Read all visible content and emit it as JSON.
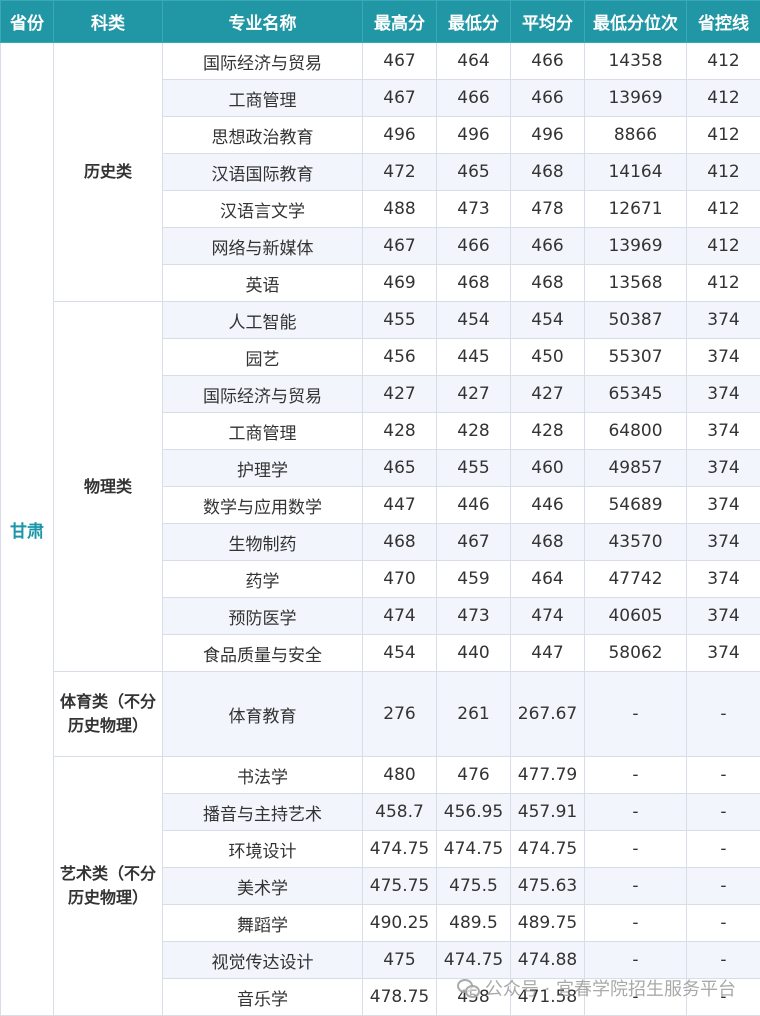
{
  "headers": [
    "省份",
    "科类",
    "专业名称",
    "最高分",
    "最低分",
    "平均分",
    "最低分位次",
    "省控线"
  ],
  "province": "甘肃",
  "groups": [
    {
      "subject": "历史类",
      "rows": [
        [
          "国际经济与贸易",
          "467",
          "464",
          "466",
          "14358",
          "412"
        ],
        [
          "工商管理",
          "467",
          "466",
          "466",
          "13969",
          "412"
        ],
        [
          "思想政治教育",
          "496",
          "496",
          "496",
          "8866",
          "412"
        ],
        [
          "汉语国际教育",
          "472",
          "465",
          "468",
          "14164",
          "412"
        ],
        [
          "汉语言文学",
          "488",
          "473",
          "478",
          "12671",
          "412"
        ],
        [
          "网络与新媒体",
          "467",
          "466",
          "466",
          "13969",
          "412"
        ],
        [
          "英语",
          "469",
          "468",
          "468",
          "13568",
          "412"
        ]
      ]
    },
    {
      "subject": "物理类",
      "rows": [
        [
          "人工智能",
          "455",
          "454",
          "454",
          "50387",
          "374"
        ],
        [
          "园艺",
          "456",
          "445",
          "450",
          "55307",
          "374"
        ],
        [
          "国际经济与贸易",
          "427",
          "427",
          "427",
          "65345",
          "374"
        ],
        [
          "工商管理",
          "428",
          "428",
          "428",
          "64800",
          "374"
        ],
        [
          "护理学",
          "465",
          "455",
          "460",
          "49857",
          "374"
        ],
        [
          "数学与应用数学",
          "447",
          "446",
          "446",
          "54689",
          "374"
        ],
        [
          "生物制药",
          "468",
          "467",
          "468",
          "43570",
          "374"
        ],
        [
          "药学",
          "470",
          "459",
          "464",
          "47742",
          "374"
        ],
        [
          "预防医学",
          "474",
          "473",
          "474",
          "40605",
          "374"
        ],
        [
          "食品质量与安全",
          "454",
          "440",
          "447",
          "58062",
          "374"
        ]
      ]
    },
    {
      "subject": "体育类（不分历史物理）",
      "tall": true,
      "rows": [
        [
          "体育教育",
          "276",
          "261",
          "267.67",
          "-",
          "-"
        ]
      ]
    },
    {
      "subject": "艺术类（不分历史物理）",
      "rows": [
        [
          "书法学",
          "480",
          "476",
          "477.79",
          "-",
          "-"
        ],
        [
          "播音与主持艺术",
          "458.7",
          "456.95",
          "457.91",
          "-",
          "-"
        ],
        [
          "环境设计",
          "474.75",
          "474.75",
          "474.75",
          "-",
          "-"
        ],
        [
          "美术学",
          "475.75",
          "475.5",
          "475.63",
          "-",
          "-"
        ],
        [
          "舞蹈学",
          "490.25",
          "489.5",
          "489.75",
          "-",
          "-"
        ],
        [
          "视觉传达设计",
          "475",
          "474.75",
          "474.88",
          "-",
          "-"
        ],
        [
          "音乐学",
          "478.75",
          "458",
          "471.58",
          "-",
          "-"
        ]
      ]
    }
  ],
  "watermark": "公众号 · 宜春学院招生服务平台",
  "colors": {
    "header_bg": "#2196a5",
    "province_text": "#1a96a8",
    "alt_row": "#f2f5fb"
  }
}
